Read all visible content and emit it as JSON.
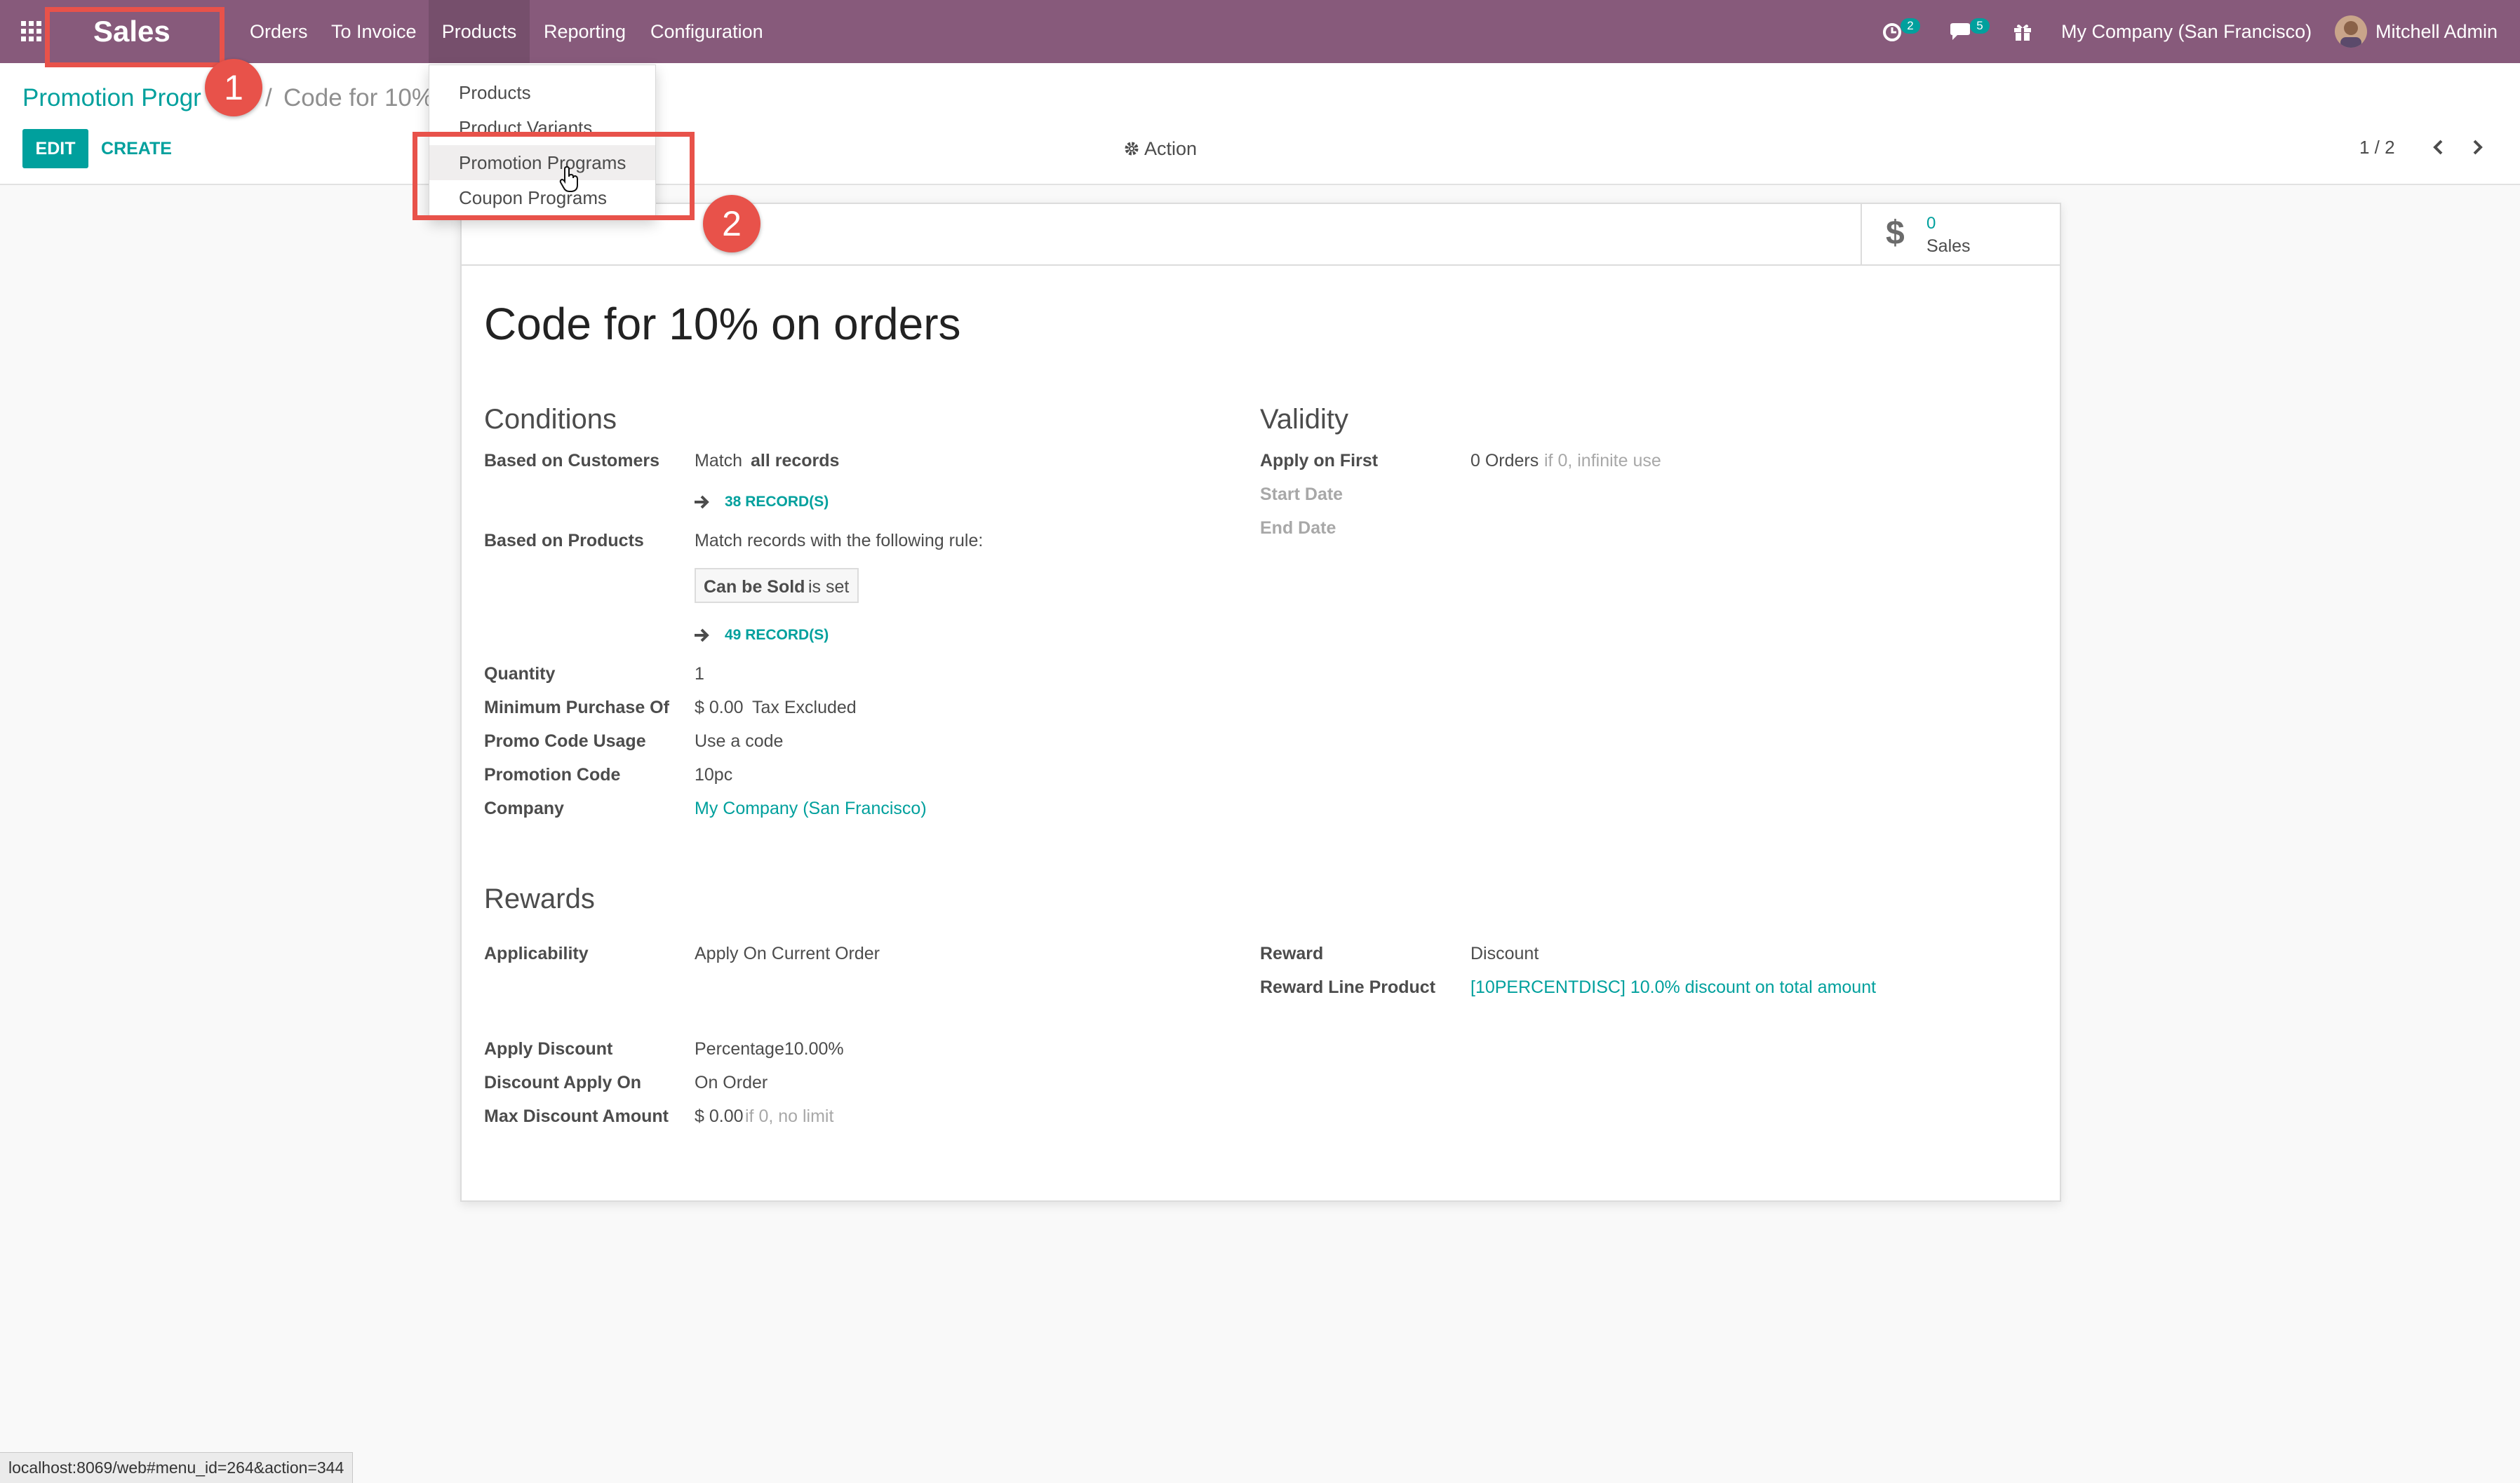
{
  "navbar": {
    "app_name": "Sales",
    "menus": [
      "Orders",
      "To Invoice",
      "Products",
      "Reporting",
      "Configuration"
    ],
    "activity_count": "2",
    "message_count": "5",
    "company": "My Company (San Francisco)",
    "user": "Mitchell Admin"
  },
  "products_menu": {
    "items": [
      "Products",
      "Product Variants",
      "Promotion Programs",
      "Coupon Programs"
    ]
  },
  "breadcrumb": {
    "parent": "Promotion Progr",
    "separator": "/",
    "current": "Code for 10%"
  },
  "toolbar": {
    "edit_label": "EDIT",
    "create_label": "CREATE",
    "action_label": "Action",
    "pager": "1 / 2"
  },
  "stat": {
    "value": "0",
    "label": "Sales",
    "icon": "dollar-icon"
  },
  "record": {
    "title": "Code for 10% on orders",
    "conditions": {
      "heading": "Conditions",
      "customers_label": "Based on Customers",
      "customers_match": "Match",
      "customers_match_bold": "all records",
      "customers_records": "38 RECORD(S)",
      "products_label": "Based on Products",
      "products_rule_text": "Match records with the following rule:",
      "rule_field": "Can be Sold",
      "rule_op": "is set",
      "products_records": "49 RECORD(S)",
      "quantity_label": "Quantity",
      "quantity_value": "1",
      "min_purchase_label": "Minimum Purchase Of",
      "min_purchase_value": "$ 0.00",
      "min_purchase_tax": "Tax Excluded",
      "usage_label": "Promo Code Usage",
      "usage_value": "Use a code",
      "code_label": "Promotion Code",
      "code_value": "10pc",
      "company_label": "Company",
      "company_value": "My Company (San Francisco)"
    },
    "validity": {
      "heading": "Validity",
      "apply_label": "Apply on First",
      "apply_value": "0 Orders",
      "apply_hint": "if 0, infinite use",
      "start_label": "Start Date",
      "end_label": "End Date"
    },
    "rewards": {
      "heading": "Rewards",
      "applicability_label": "Applicability",
      "applicability_value": "Apply On Current Order",
      "reward_label": "Reward",
      "reward_value": "Discount",
      "reward_line_label": "Reward Line Product",
      "reward_line_value": "[10PERCENTDISC] 10.0% discount on total amount",
      "apply_discount_label": "Apply Discount",
      "apply_discount_value": "Percentage10.00%",
      "discount_on_label": "Discount Apply On",
      "discount_on_value": "On Order",
      "max_discount_label": "Max Discount Amount",
      "max_discount_value": "$ 0.00",
      "max_discount_hint": "if 0, no limit"
    }
  },
  "annotations": {
    "step1": "1",
    "step2": "2"
  },
  "status_bar": "localhost:8069/web#menu_id=264&action=344",
  "colors": {
    "navbar": "#875a7b",
    "accent": "#00a09d",
    "annotation": "#e8524a"
  }
}
